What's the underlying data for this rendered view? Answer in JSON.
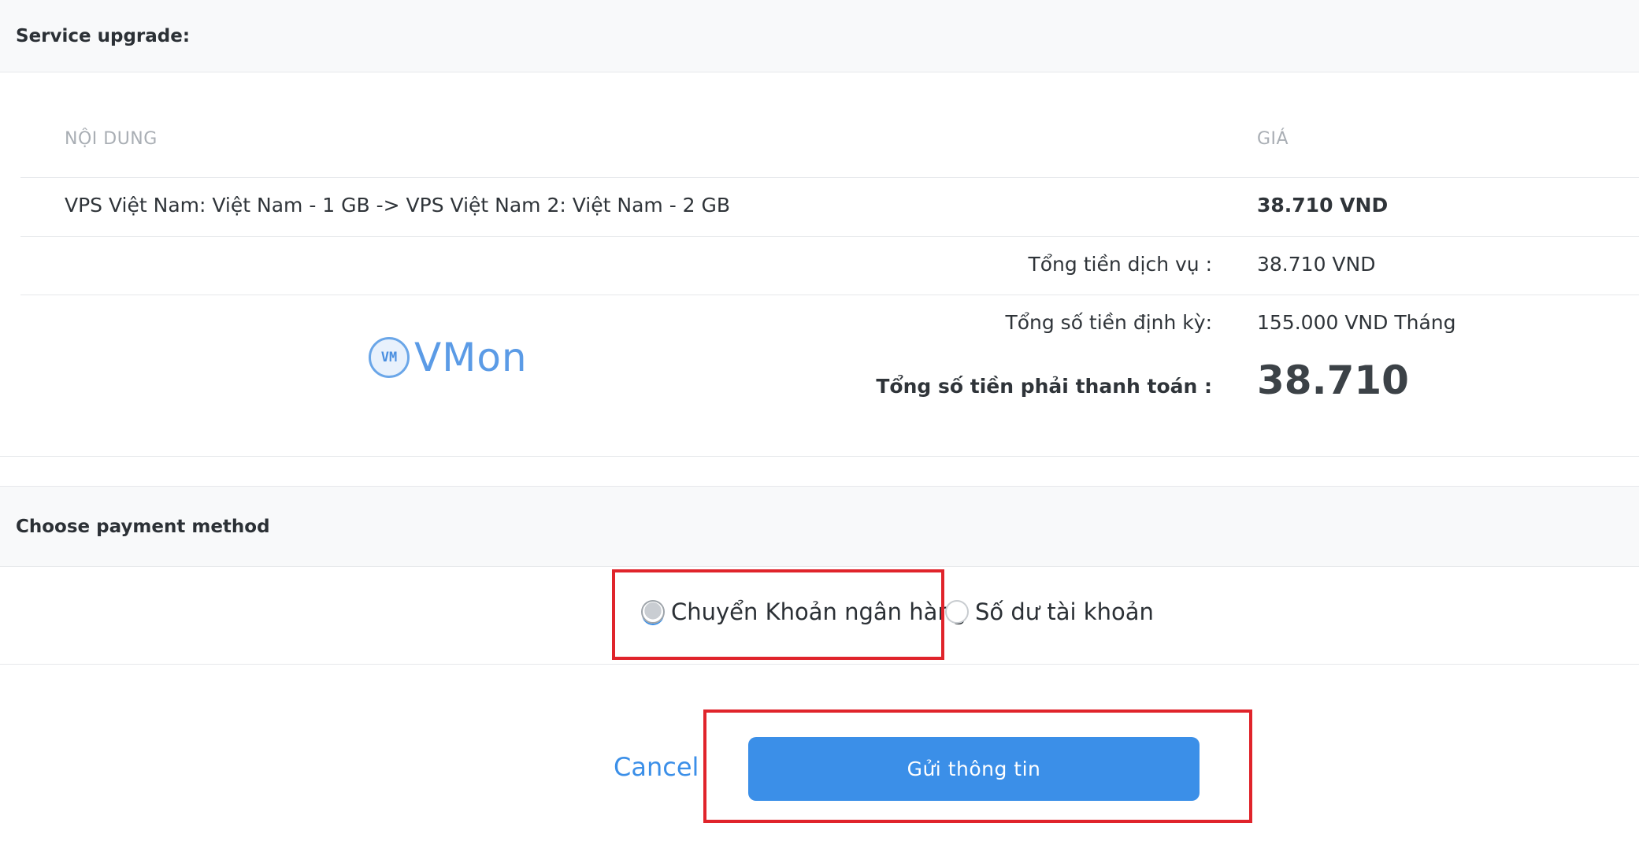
{
  "upgrade_header": {
    "title": "Service upgrade:"
  },
  "table": {
    "columns": {
      "content": "NỘI DUNG",
      "price": "GIÁ"
    },
    "rows": [
      {
        "content": "VPS Việt Nam: Việt Nam - 1 GB -> VPS Việt Nam 2: Việt Nam - 2 GB",
        "price": "38.710 VND"
      }
    ]
  },
  "summary": {
    "service_total_label": "Tổng tiền dịch vụ :",
    "service_total_value": "38.710 VND",
    "recurring_label": "Tổng số tiền định kỳ:",
    "recurring_value": "155.000 VND Tháng",
    "grand_total_label": "Tổng số tiền phải thanh toán :",
    "grand_total_value": "38.710"
  },
  "logo": {
    "mark": "VM",
    "text": "VMon"
  },
  "payment": {
    "title": "Choose payment method",
    "options": [
      {
        "label": "Chuyển Khoản ngân hàng",
        "selected": true
      },
      {
        "label": "Số dư tài khoản",
        "selected": false
      }
    ]
  },
  "actions": {
    "cancel_label": "Cancel",
    "submit_label": "Gửi thông tin"
  },
  "colors": {
    "accent": "#3b8fe8",
    "highlight": "#e0242b",
    "header_bg": "#f8f9fa"
  }
}
